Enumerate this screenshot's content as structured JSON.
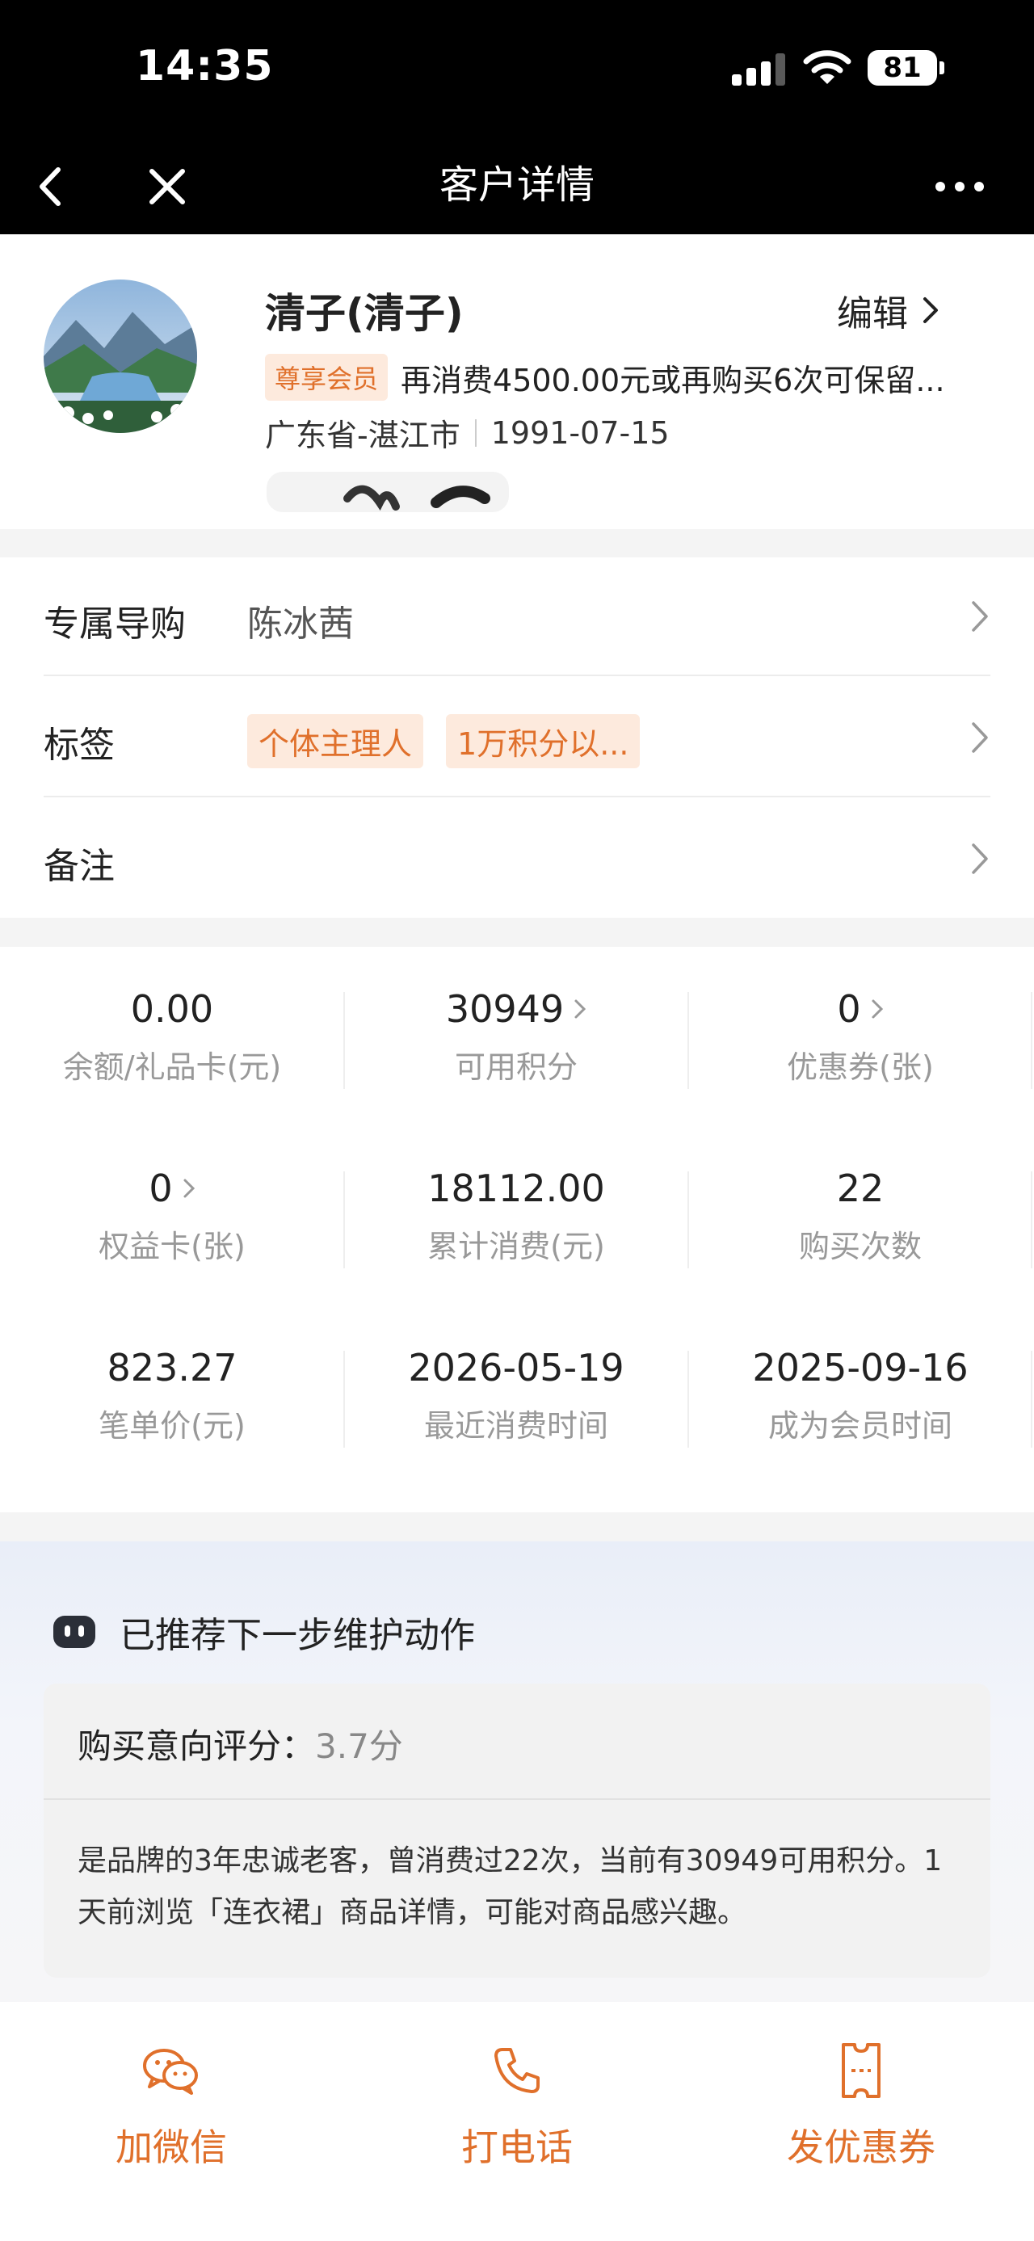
{
  "status_bar": {
    "time": "14:35",
    "battery": "81"
  },
  "nav": {
    "title": "客户详情"
  },
  "profile": {
    "name": "清子(清子)",
    "edit_label": "编辑",
    "member_badge": "尊享会员",
    "member_text": "再消费4500.00元或再购买6次可保留...",
    "region": "广东省-湛江市",
    "birthday": "1991-07-15"
  },
  "list": {
    "guide_label": "专属导购",
    "guide_value": "陈冰茜",
    "tags_label": "标签",
    "tags": [
      "个体主理人",
      "1万积分以..."
    ],
    "note_label": "备注"
  },
  "stats": [
    {
      "value": "0.00",
      "caption": "余额/礼品卡(元)"
    },
    {
      "value": "30949",
      "caption": "可用积分"
    },
    {
      "value": "0",
      "caption": "优惠券(张)"
    },
    {
      "value": "0",
      "caption": "权益卡(张)"
    },
    {
      "value": "18112.00",
      "caption": "累计消费(元)"
    },
    {
      "value": "22",
      "caption": "购买次数"
    },
    {
      "value": "823.27",
      "caption": "笔单价(元)"
    },
    {
      "value": "2026-05-19",
      "caption": "最近消费时间"
    },
    {
      "value": "2025-09-16",
      "caption": "成为会员时间"
    }
  ],
  "recommend": {
    "title": "已推荐下一步维护动作",
    "score_label": "购买意向评分：",
    "score_value": "3.7分",
    "text": "是品牌的3年忠诚老客，曾消费过22次，当前有30949可用积分。1天前浏览「连衣裙」商品详情，可能对商品感兴趣。"
  },
  "actions": [
    {
      "label": "加微信",
      "icon": "wechat-icon"
    },
    {
      "label": "打电话",
      "icon": "phone-icon"
    },
    {
      "label": "发优惠券",
      "icon": "coupon-icon"
    }
  ],
  "colors": {
    "accent": "#e0702b",
    "badge_bg": "#fdeadd"
  }
}
